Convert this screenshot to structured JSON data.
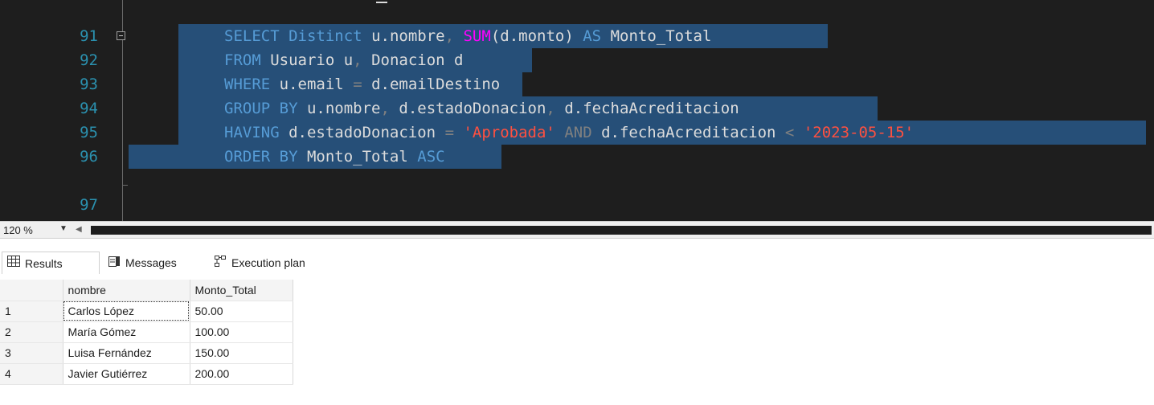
{
  "editor": {
    "lines": [
      {
        "num": "91"
      },
      {
        "num": "92"
      },
      {
        "num": "93"
      },
      {
        "num": "94"
      },
      {
        "num": "95"
      },
      {
        "num": "96"
      },
      {
        "num": "97"
      }
    ],
    "tokens": {
      "l91": [
        "SELECT",
        "Distinct",
        "u.nombre",
        ",",
        "SUM",
        "(d.monto)",
        "AS",
        "Monto_Total"
      ],
      "l92": [
        "FROM",
        "Usuario u",
        ",",
        "Donacion d"
      ],
      "l93": [
        "WHERE",
        "u.email",
        "=",
        "d.emailDestino"
      ],
      "l94": [
        "GROUP BY",
        "u.nombre",
        ",",
        "d.estadoDonacion",
        ",",
        "d.fechaAcreditacion"
      ],
      "l95": [
        "HAVING",
        "d.estadoDonacion",
        "=",
        "'Aprobada'",
        "AND",
        "d.fechaAcreditacion",
        "<",
        "'2023-05-15'"
      ],
      "l96": [
        "ORDER BY",
        "Monto_Total",
        "ASC"
      ]
    },
    "colors": {
      "background": "#1e1e1e",
      "selection": "#264f78",
      "keyword": "#569cd6",
      "function": "#ff00ff",
      "string": "#ff5040",
      "line_number": "#2b91af"
    }
  },
  "statusbar": {
    "zoom": "120 %"
  },
  "results": {
    "tabs": [
      {
        "label": "Results",
        "icon": "grid-icon"
      },
      {
        "label": "Messages",
        "icon": "messages-icon"
      },
      {
        "label": "Execution plan",
        "icon": "execution-plan-icon"
      }
    ],
    "columns": [
      "nombre",
      "Monto_Total"
    ],
    "rows": [
      {
        "n": "1",
        "nombre": "Carlos López",
        "monto": "50.00"
      },
      {
        "n": "2",
        "nombre": "María Gómez",
        "monto": "100.00"
      },
      {
        "n": "3",
        "nombre": "Luisa Fernández",
        "monto": "150.00"
      },
      {
        "n": "4",
        "nombre": "Javier Gutiérrez",
        "monto": "200.00"
      }
    ]
  }
}
